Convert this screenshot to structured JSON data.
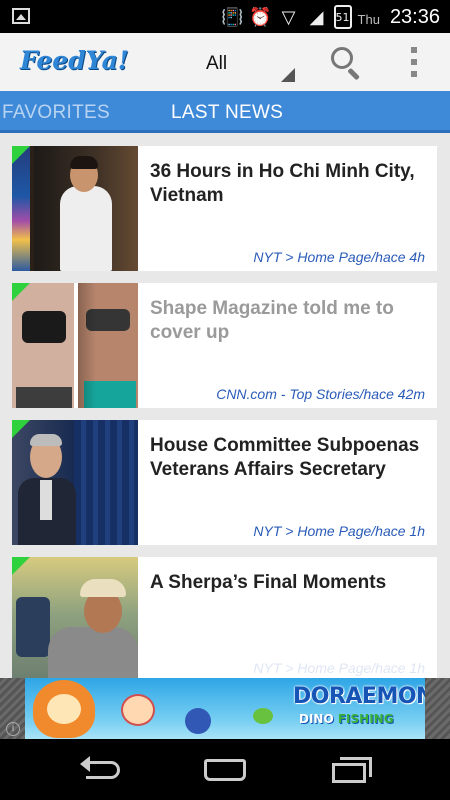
{
  "status_bar": {
    "day": "Thu",
    "time": "23:36",
    "battery_level": "51",
    "icons": [
      "gallery-icon",
      "vibrate-icon",
      "alarm-icon",
      "wifi-icon",
      "signal-icon",
      "battery-icon"
    ]
  },
  "app_bar": {
    "logo_text": "FeedYa!",
    "filter": {
      "selected": "All"
    },
    "icons": [
      "search-icon",
      "overflow-menu-icon"
    ]
  },
  "tabs": [
    {
      "label": "FAVORITES",
      "active": false
    },
    {
      "label": "LAST NEWS",
      "active": true
    }
  ],
  "feed": {
    "items": [
      {
        "title": "36 Hours in Ho Chi Minh City, Vietnam",
        "source": "NYT > Home Page/hace 4h",
        "read": false,
        "new": true
      },
      {
        "title": "Shape Magazine told me to cover up",
        "source": "CNN.com - Top Stories/hace 42m",
        "read": true,
        "new": true
      },
      {
        "title": "House Committee Subpoenas Veterans Affairs Secretary",
        "source": "NYT > Home Page/hace 1h",
        "read": false,
        "new": true
      },
      {
        "title": "A Sherpa’s Final Moments",
        "source": "NYT > Home Page/hace 1h",
        "read": false,
        "new": true
      }
    ]
  },
  "ad": {
    "brand": "DORAEMON",
    "subtitle_prefix": "DINO",
    "subtitle_suffix": "FISHING",
    "info_glyph": "i"
  },
  "nav_bar": {
    "buttons": [
      "back-icon",
      "home-icon",
      "recent-apps-icon"
    ]
  },
  "colors": {
    "accent": "#3f8ad8",
    "source_link": "#2a5bb8",
    "new_marker": "#2fd23d",
    "read_title": "#9a9a9a"
  }
}
